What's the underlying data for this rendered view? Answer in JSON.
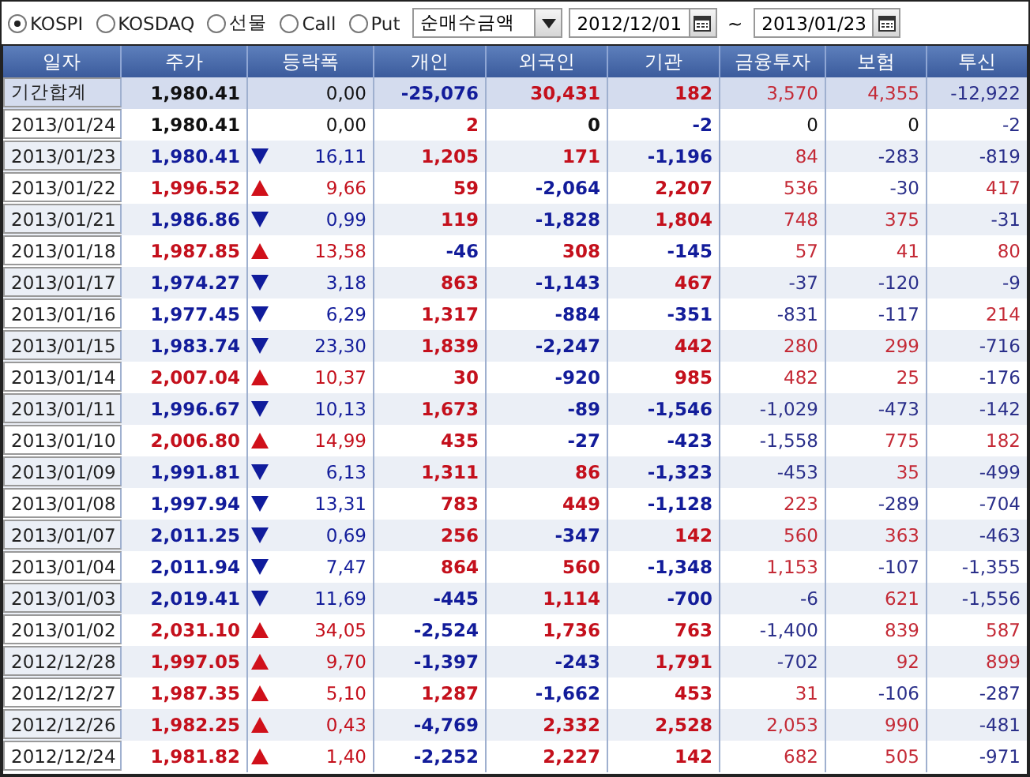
{
  "filters": {
    "markets": [
      {
        "label": "KOSPI",
        "selected": true
      },
      {
        "label": "KOSDAQ",
        "selected": false
      },
      {
        "label": "선물",
        "selected": false
      },
      {
        "label": "Call",
        "selected": false
      },
      {
        "label": "Put",
        "selected": false
      }
    ],
    "measure": {
      "value": "순매수금액"
    },
    "date_from": "2012/12/01",
    "range_separator": "~",
    "date_to": "2013/01/23"
  },
  "table": {
    "columns": [
      "일자",
      "주가",
      "등락폭",
      "개인",
      "외국인",
      "기관",
      "금융투자",
      "보험",
      "투신"
    ],
    "summary": {
      "date": "기간합계",
      "price": "1,980.41",
      "diff": "0,00",
      "values": [
        "-25,076",
        "30,431",
        "182",
        "3,570",
        "4,355",
        "-12,922"
      ]
    },
    "rows": [
      {
        "date": "2013/01/24",
        "price": "1,980.41",
        "kind": "flat",
        "diff": "0,00",
        "values": [
          "2",
          "0",
          "-2",
          "0",
          "0",
          "-2"
        ]
      },
      {
        "date": "2013/01/23",
        "price": "1,980.41",
        "kind": "down",
        "diff": "16,11",
        "values": [
          "1,205",
          "171",
          "-1,196",
          "84",
          "-283",
          "-819"
        ]
      },
      {
        "date": "2013/01/22",
        "price": "1,996.52",
        "kind": "up",
        "diff": "9,66",
        "values": [
          "59",
          "-2,064",
          "2,207",
          "536",
          "-30",
          "417"
        ]
      },
      {
        "date": "2013/01/21",
        "price": "1,986.86",
        "kind": "down",
        "diff": "0,99",
        "values": [
          "119",
          "-1,828",
          "1,804",
          "748",
          "375",
          "-31"
        ]
      },
      {
        "date": "2013/01/18",
        "price": "1,987.85",
        "kind": "up",
        "diff": "13,58",
        "values": [
          "-46",
          "308",
          "-145",
          "57",
          "41",
          "80"
        ]
      },
      {
        "date": "2013/01/17",
        "price": "1,974.27",
        "kind": "down",
        "diff": "3,18",
        "values": [
          "863",
          "-1,143",
          "467",
          "-37",
          "-120",
          "-9"
        ]
      },
      {
        "date": "2013/01/16",
        "price": "1,977.45",
        "kind": "down",
        "diff": "6,29",
        "values": [
          "1,317",
          "-884",
          "-351",
          "-831",
          "-117",
          "214"
        ]
      },
      {
        "date": "2013/01/15",
        "price": "1,983.74",
        "kind": "down",
        "diff": "23,30",
        "values": [
          "1,839",
          "-2,247",
          "442",
          "280",
          "299",
          "-716"
        ]
      },
      {
        "date": "2013/01/14",
        "price": "2,007.04",
        "kind": "up",
        "diff": "10,37",
        "values": [
          "30",
          "-920",
          "985",
          "482",
          "25",
          "-176"
        ]
      },
      {
        "date": "2013/01/11",
        "price": "1,996.67",
        "kind": "down",
        "diff": "10,13",
        "values": [
          "1,673",
          "-89",
          "-1,546",
          "-1,029",
          "-473",
          "-142"
        ]
      },
      {
        "date": "2013/01/10",
        "price": "2,006.80",
        "kind": "up",
        "diff": "14,99",
        "values": [
          "435",
          "-27",
          "-423",
          "-1,558",
          "775",
          "182"
        ]
      },
      {
        "date": "2013/01/09",
        "price": "1,991.81",
        "kind": "down",
        "diff": "6,13",
        "values": [
          "1,311",
          "86",
          "-1,323",
          "-453",
          "35",
          "-499"
        ]
      },
      {
        "date": "2013/01/08",
        "price": "1,997.94",
        "kind": "down",
        "diff": "13,31",
        "values": [
          "783",
          "449",
          "-1,128",
          "223",
          "-289",
          "-704"
        ]
      },
      {
        "date": "2013/01/07",
        "price": "2,011.25",
        "kind": "down",
        "diff": "0,69",
        "values": [
          "256",
          "-347",
          "142",
          "560",
          "363",
          "-463"
        ]
      },
      {
        "date": "2013/01/04",
        "price": "2,011.94",
        "kind": "down",
        "diff": "7,47",
        "values": [
          "864",
          "560",
          "-1,348",
          "1,153",
          "-107",
          "-1,355"
        ]
      },
      {
        "date": "2013/01/03",
        "price": "2,019.41",
        "kind": "down",
        "diff": "11,69",
        "values": [
          "-445",
          "1,114",
          "-700",
          "-6",
          "621",
          "-1,556"
        ]
      },
      {
        "date": "2013/01/02",
        "price": "2,031.10",
        "kind": "up",
        "diff": "34,05",
        "values": [
          "-2,524",
          "1,736",
          "763",
          "-1,400",
          "839",
          "587"
        ]
      },
      {
        "date": "2012/12/28",
        "price": "1,997.05",
        "kind": "up",
        "diff": "9,70",
        "values": [
          "-1,397",
          "-243",
          "1,791",
          "-702",
          "92",
          "899"
        ]
      },
      {
        "date": "2012/12/27",
        "price": "1,987.35",
        "kind": "up",
        "diff": "5,10",
        "values": [
          "1,287",
          "-1,662",
          "453",
          "31",
          "-106",
          "-287"
        ]
      },
      {
        "date": "2012/12/26",
        "price": "1,982.25",
        "kind": "up",
        "diff": "0,43",
        "values": [
          "-4,769",
          "2,332",
          "2,528",
          "2,053",
          "990",
          "-481"
        ]
      },
      {
        "date": "2012/12/24",
        "price": "1,981.82",
        "kind": "up",
        "diff": "1,40",
        "values": [
          "-2,252",
          "2,227",
          "142",
          "682",
          "505",
          "-971"
        ]
      }
    ]
  }
}
